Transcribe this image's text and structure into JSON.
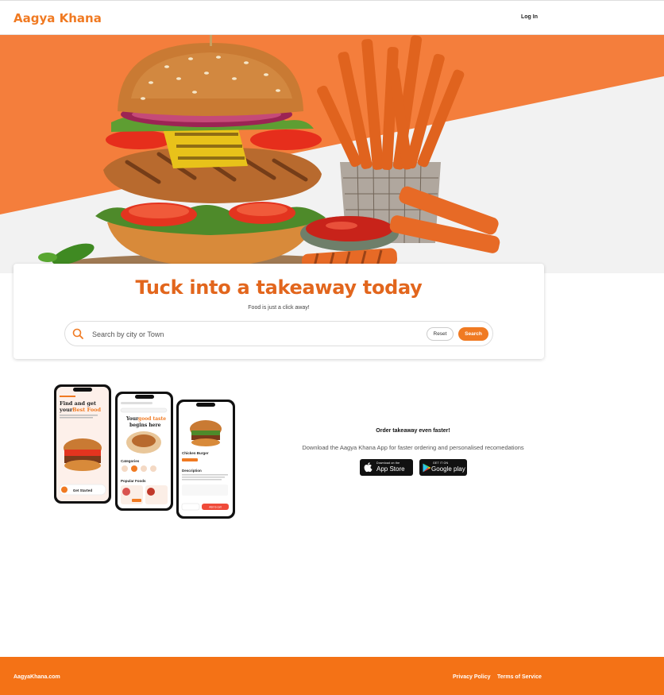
{
  "header": {
    "brand": "Aagya Khana",
    "login_label": "Log In"
  },
  "hero": {
    "colors": {
      "orange": "#f47e3c",
      "grey": "#f2f2f2"
    }
  },
  "search_card": {
    "title": "Tuck into a takeaway today",
    "subtitle": "Food is just a click away!",
    "search_placeholder": "Search by city or Town",
    "reset_label": "Reset",
    "search_label": "Search"
  },
  "phones": {
    "phone1": {
      "headline_1": "Find and get",
      "headline_2": "your",
      "headline_accent": "Best Food",
      "cta": "Get Started"
    },
    "phone2": {
      "headline_1": "Your",
      "headline_accent": "good taste",
      "headline_2": "begins here",
      "section_1": "Categories",
      "section_2": "Popular Foods"
    },
    "phone3": {
      "title": "Chicken Burger",
      "section": "Description",
      "cta": "Add to cart"
    }
  },
  "promo": {
    "title": "Order takeaway even faster!",
    "description": "Download the Aagya Khana App for faster ordering and personalised recomedations",
    "app_store_small": "Download on the",
    "app_store_big": "App Store",
    "google_small": "GET IT ON",
    "google_big": "Google play"
  },
  "footer": {
    "brand": "AagyaKhana.com",
    "privacy": "Privacy Policy",
    "terms": "Terms of Service"
  },
  "colors": {
    "accent": "#f07a22",
    "title": "#e2661d",
    "footer": "#f47216"
  }
}
